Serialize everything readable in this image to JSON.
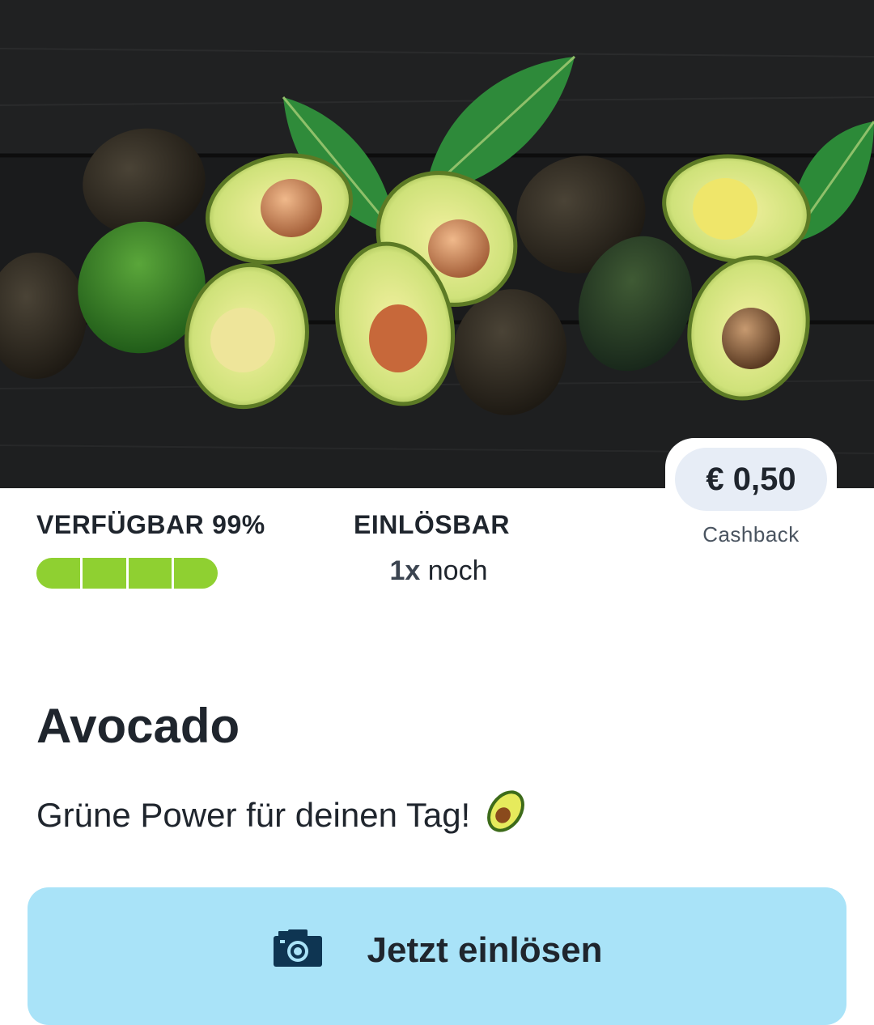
{
  "offer": {
    "image_icon": "avocado-photo",
    "price": "€ 0,50",
    "price_caption": "Cashback",
    "availability": {
      "label": "VERFÜGBAR",
      "percent_text": "99%",
      "fraction": 0.99
    },
    "redeemable": {
      "label": "EINLÖSBAR",
      "count": "1x",
      "suffix": "noch"
    },
    "title": "Avocado",
    "description": "Grüne Power für deinen Tag!",
    "description_icon": "avocado-emoji"
  },
  "cta": {
    "label": "Jetzt einlösen",
    "icon": "camera-icon"
  },
  "colors": {
    "progress": "#8fd031",
    "cta_background": "#a9e3f8",
    "price_pill": "#e7edf6"
  }
}
